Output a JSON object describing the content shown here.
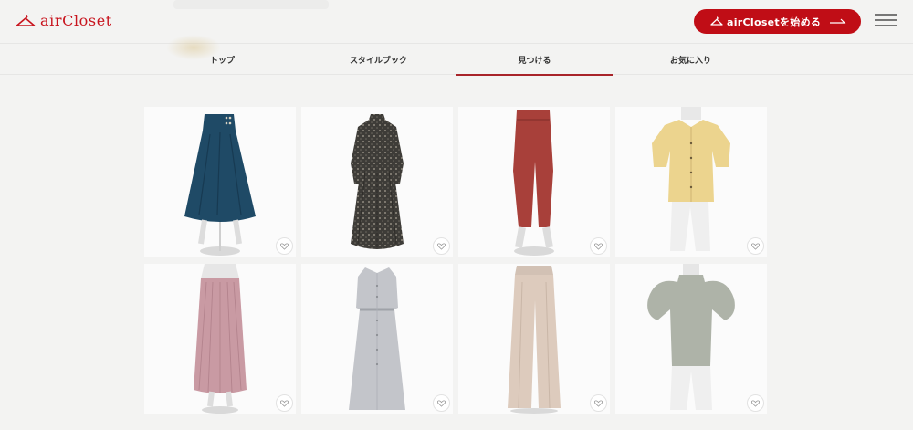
{
  "brand": {
    "name": "airCloset",
    "color": "#c8141e"
  },
  "header": {
    "cta_label": "airClosetを始める",
    "cta_color": "#c00d16",
    "menu_icon": "hamburger-icon"
  },
  "tabs": [
    {
      "label": "トップ",
      "active": false
    },
    {
      "label": "スタイルブック",
      "active": false
    },
    {
      "label": "見つける",
      "active": true
    },
    {
      "label": "お気に入り",
      "active": false
    }
  ],
  "items": [
    {
      "kind": "flared-skirt",
      "color": "#1f4a66",
      "fav_icon": "heart-icon"
    },
    {
      "kind": "patterned-dress",
      "color": "#3e3c38",
      "fav_icon": "heart-icon"
    },
    {
      "kind": "tapered-pants",
      "color": "#a8403a",
      "fav_icon": "heart-icon"
    },
    {
      "kind": "blouse",
      "color": "#ecd48e",
      "fav_icon": "heart-icon"
    },
    {
      "kind": "pleated-skirt",
      "color": "#c99aa3",
      "fav_icon": "heart-icon"
    },
    {
      "kind": "shirt-dress",
      "color": "#c3c5ca",
      "fav_icon": "heart-icon"
    },
    {
      "kind": "wide-pants",
      "color": "#ddcbbd",
      "fav_icon": "heart-icon"
    },
    {
      "kind": "puff-sleeve-top",
      "color": "#aeb3a8",
      "fav_icon": "heart-icon"
    }
  ]
}
